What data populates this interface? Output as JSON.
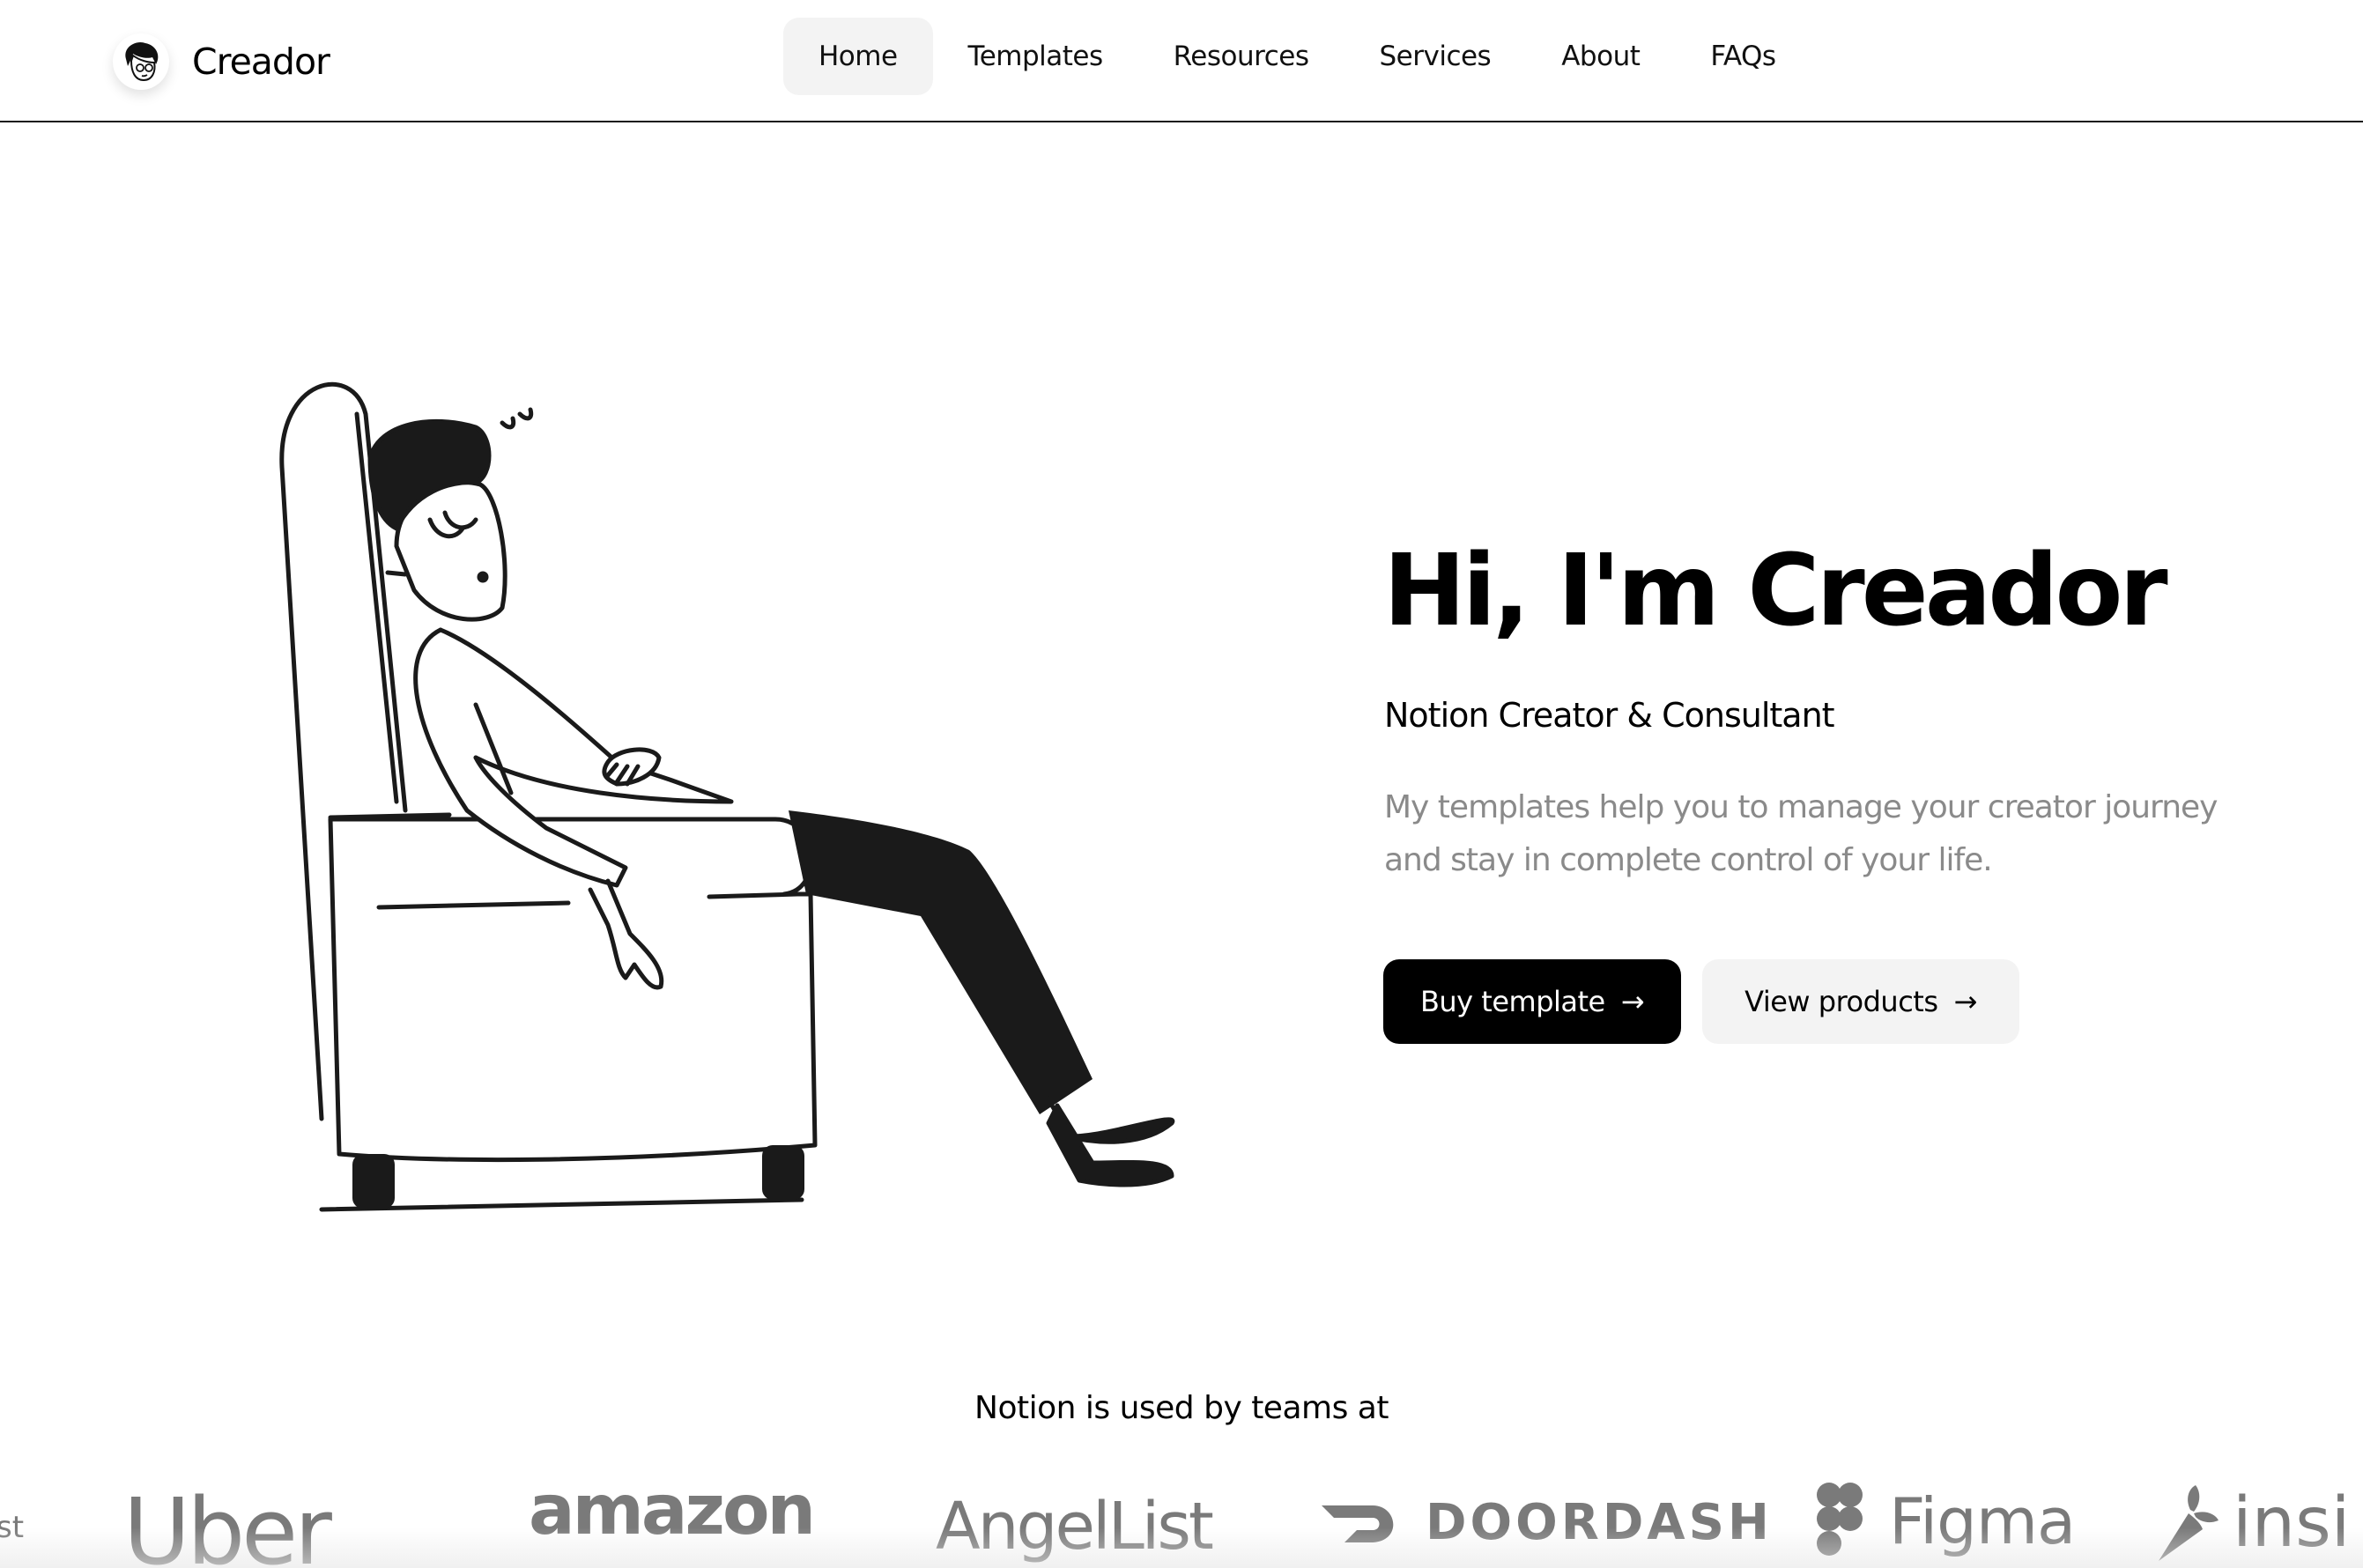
{
  "header": {
    "brand_name": "Creador",
    "nav": [
      {
        "label": "Home",
        "active": true
      },
      {
        "label": "Templates",
        "active": false
      },
      {
        "label": "Resources",
        "active": false
      },
      {
        "label": "Services",
        "active": false
      },
      {
        "label": "About",
        "active": false
      },
      {
        "label": "FAQs",
        "active": false
      }
    ]
  },
  "hero": {
    "title": "Hi, I'm Creador",
    "subtitle": "Notion Creator & Consultant",
    "description": "My templates help you to manage your creator journey and stay in complete control of your life.",
    "primary_button": "Buy template",
    "secondary_button": "View products",
    "illustration_icon": "man-sleeping-in-armchair-illustration"
  },
  "logos": {
    "label": "Notion is used by teams at",
    "items": [
      "st",
      "Uber",
      "amazon",
      "AngelList",
      "DOORDASH",
      "Figma",
      "insi"
    ]
  },
  "colors": {
    "primary_button_bg": "#000000",
    "secondary_button_bg": "#f3f3f3",
    "muted_text": "#8a8a8a",
    "logo_gray": "#7a7a7a"
  }
}
